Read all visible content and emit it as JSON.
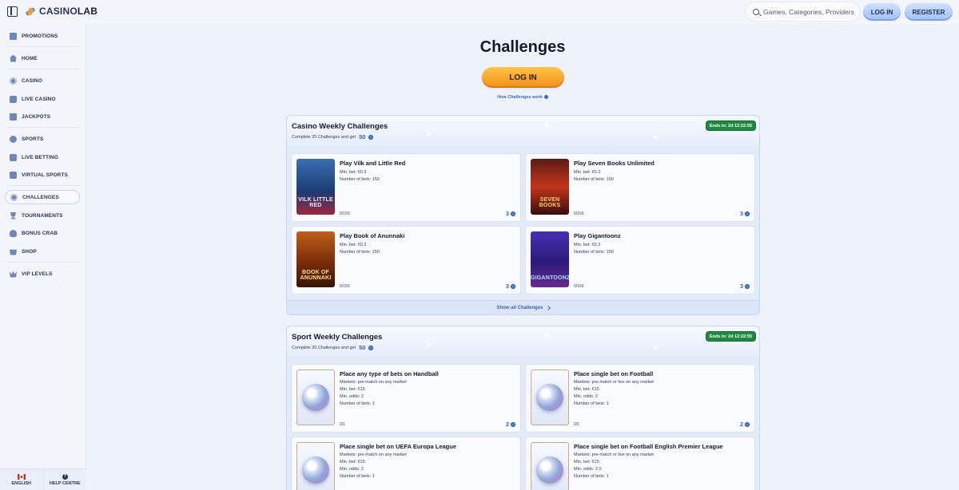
{
  "header": {
    "brand_casino": "CASINO",
    "brand_lab": "LAB",
    "search_placeholder": "Games, Categories, Providers",
    "login_label": "LOG IN",
    "register_label": "REGISTER"
  },
  "sidebar": {
    "items": [
      {
        "label": "PROMOTIONS",
        "icon": "gift-icon"
      },
      {
        "label": "HOME",
        "icon": "home-icon"
      },
      {
        "label": "CASINO",
        "icon": "chip-icon"
      },
      {
        "label": "LIVE CASINO",
        "icon": "live-tv-icon"
      },
      {
        "label": "JACKPOTS",
        "icon": "jackpot-icon"
      },
      {
        "label": "SPORTS",
        "icon": "sports-ball-icon"
      },
      {
        "label": "LIVE BETTING",
        "icon": "live-betting-icon"
      },
      {
        "label": "VIRTUAL SPORTS",
        "icon": "virtual-sports-icon"
      },
      {
        "label": "CHALLENGES",
        "icon": "challenges-icon"
      },
      {
        "label": "TOURNAMENTS",
        "icon": "trophy-icon"
      },
      {
        "label": "BONUS CRAB",
        "icon": "crab-icon"
      },
      {
        "label": "SHOP",
        "icon": "shop-icon"
      },
      {
        "label": "VIP LEVELS",
        "icon": "crown-icon"
      }
    ],
    "active": "CHALLENGES",
    "footer": {
      "language_label": "ENGLISH",
      "help_label": "HELP CENTRE"
    }
  },
  "main": {
    "title": "Challenges",
    "login_label": "LOG IN",
    "how_link": "How Challenges work",
    "sections": [
      {
        "title": "Casino Weekly Challenges",
        "subtitle": "Complete 20 Challenges and get",
        "reward": "50",
        "ends": "Ends in: 2d 12:22:55",
        "show_all": "Show all Challenges",
        "cards": [
          {
            "title": "Play Vilk and Little Red",
            "lines": [
              "Min. bet: €0.3",
              "Number of bets: 150"
            ],
            "progress": "0/150",
            "reward": "3",
            "caption": "VILK LITTLE RED"
          },
          {
            "title": "Play Seven Books Unlimited",
            "lines": [
              "Min. bet: €0.3",
              "Number of bets: 150"
            ],
            "progress": "0/150",
            "reward": "3",
            "caption": "SEVEN BOOKS"
          },
          {
            "title": "Play Book of Anunnaki",
            "lines": [
              "Min. bet: €0.3",
              "Number of bets: 150"
            ],
            "progress": "0/150",
            "reward": "3",
            "caption": "BOOK OF ANUNNAKI"
          },
          {
            "title": "Play Gigantoonz",
            "lines": [
              "Min. bet: €0.3",
              "Number of bets: 150"
            ],
            "progress": "0/150",
            "reward": "3",
            "caption": "GIGANTOONZ"
          }
        ]
      },
      {
        "title": "Sport Weekly Challenges",
        "subtitle": "Complete 20 Challenges and get",
        "reward": "50",
        "ends": "Ends in: 2d 12:22:55",
        "cards": [
          {
            "title": "Place any type of bets on Handball",
            "lines": [
              "Markets: pre-match on any market",
              "Min. bet: €15",
              "Min. odds: 2",
              "Number of bets: 1"
            ],
            "progress": "0/1",
            "reward": "2"
          },
          {
            "title": "Place single bet on Football",
            "lines": [
              "Markets: pre-match or live on any market",
              "Min. bet: €15",
              "Min. odds: 2",
              "Number of bets: 1"
            ],
            "progress": "0/1",
            "reward": "2"
          },
          {
            "title": "Place single bet on UEFA Europa League",
            "lines": [
              "Markets: pre-match on any market",
              "Min. bet: €15",
              "Min. odds: 2",
              "Number of bets: 1"
            ],
            "progress": "",
            "reward": ""
          },
          {
            "title": "Place single bet on Football English Premier League",
            "lines": [
              "Markets: pre-match or live on any market",
              "Min. bet: €15",
              "Min. odds: 2.0",
              "Number of bets: 1"
            ],
            "progress": "",
            "reward": ""
          }
        ]
      }
    ]
  },
  "colors": {
    "accent_blue": "#3d67b8",
    "login_orange": "#f5a623",
    "badge_green": "#1f8a3f"
  }
}
